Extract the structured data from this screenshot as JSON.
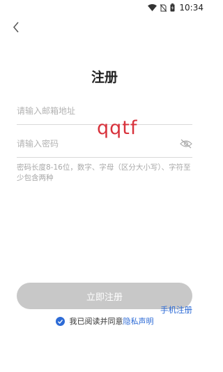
{
  "status": {
    "time": "10:34"
  },
  "header": {
    "title": "注册"
  },
  "form": {
    "email_placeholder": "请输入邮箱地址",
    "email_value": "",
    "password_placeholder": "请输入密码",
    "password_value": "",
    "hint": "密码长度8-16位，数字、字母（区分大小写）、字符至少包含两种",
    "overlay_text": "qqtf"
  },
  "actions": {
    "register_label": "立即注册",
    "phone_register_label": "手机注册"
  },
  "agreement": {
    "prefix": "我已阅读并同意",
    "link": "隐私声明",
    "checked": true
  },
  "colors": {
    "accent": "#2d6bd6",
    "button_disabled": "#c8c8c8",
    "overlay_red": "#d8323c"
  },
  "icons": [
    "wifi-icon",
    "no-sim-icon",
    "battery-charging-icon",
    "back-arrow-icon",
    "eye-off-icon",
    "check-circle-icon"
  ]
}
